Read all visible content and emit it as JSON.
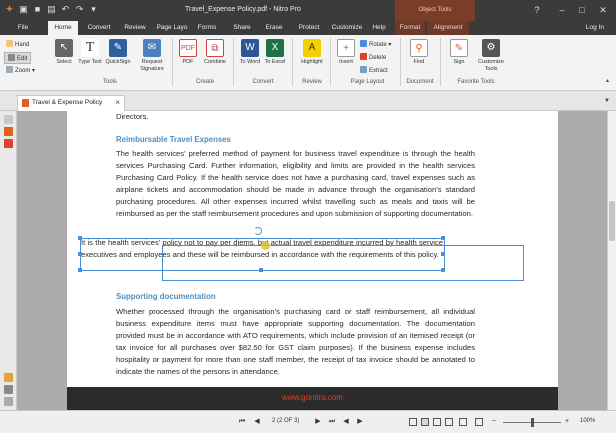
{
  "window": {
    "title": "Travel_Expense Policy.pdf - Nitro Pro",
    "context_group": "Object Tools",
    "login": "Log In",
    "colors": {
      "titlebar": "#3b3b3b",
      "accent": "#f07a1e",
      "context": "#7a3d2a",
      "link": "#4f8fbf",
      "selection": "#4a90d9"
    }
  },
  "ribbon_tabs": [
    "File",
    "Home",
    "Convert",
    "Review",
    "Page Layo",
    "Forms",
    "Share",
    "Erase",
    "Protect",
    "Customize",
    "Help",
    "Format",
    "Alignment"
  ],
  "ribbon": {
    "hand": "Hand",
    "edit": "Edit",
    "zoom": "Zoom",
    "select": "Select",
    "type_text": "Type Text",
    "quicksign": "QuickSign",
    "request_signature": "Request Signature",
    "pdf": "PDF",
    "combine": "Combine",
    "to_word": "To Word",
    "to_excel": "To Excel",
    "highlight": "Highlight",
    "insert": "Insert",
    "rotate": "Rotate",
    "delete": "Delete",
    "extract": "Extract",
    "find": "Find",
    "sign": "Sign",
    "customize_tools": "Customize Tools",
    "groups": {
      "tools": "Tools",
      "create": "Create",
      "convert": "Convert",
      "review": "Review",
      "page_layout": "Page Layout",
      "document": "Document",
      "favorite_tools": "Favorite Tools"
    }
  },
  "doc_tab": {
    "label": "Travel & Expense Policy"
  },
  "document": {
    "top_line": "Directors.",
    "heading1": "Reimbursable Travel Expenses",
    "para1": "The health services’ preferred method of payment for business travel expenditure is through the health services Purchasing Card. Further information, eligibility and limits are provided in the health services Purchasing Card Policy. If the health service does not have a purchasing card, travel expenses such as airplane tickets and accommodation should be made in advance through the organisation’s standard purchasing procedures. All other expenses incurred whilst travelling such as meals and taxis will be reimbursed as per the staff reimbursement procedures and upon submission of supporting documentation.",
    "selected_para": "It is the health services’ policy not to pay per diems, but actual travel expenditure incurred by health service executives and employees and these will be reimbursed in accordance with the requirements of this policy.",
    "heading2": "Supporting documentation",
    "para2": "Whether processed through the organisation’s purchasing card or staff reimbursement, all individual business expenditure items must have appropriate supporting documentation. The documentation provided must be in accordance with ATO requirements, which include provision of an itemised receipt (or tax invoice for all purchases over $82.50 for GST claim purposes). If the business expense includes hospitality or payment for more than one staff member, the receipt of tax invoice should be annotated to indicate the names of the persons in attendance.",
    "footer_url": "www.gonitro.com"
  },
  "status": {
    "page_indicator": "2 (2 OF 3)",
    "zoom": "100%",
    "zoom_fraction": 0.5
  }
}
